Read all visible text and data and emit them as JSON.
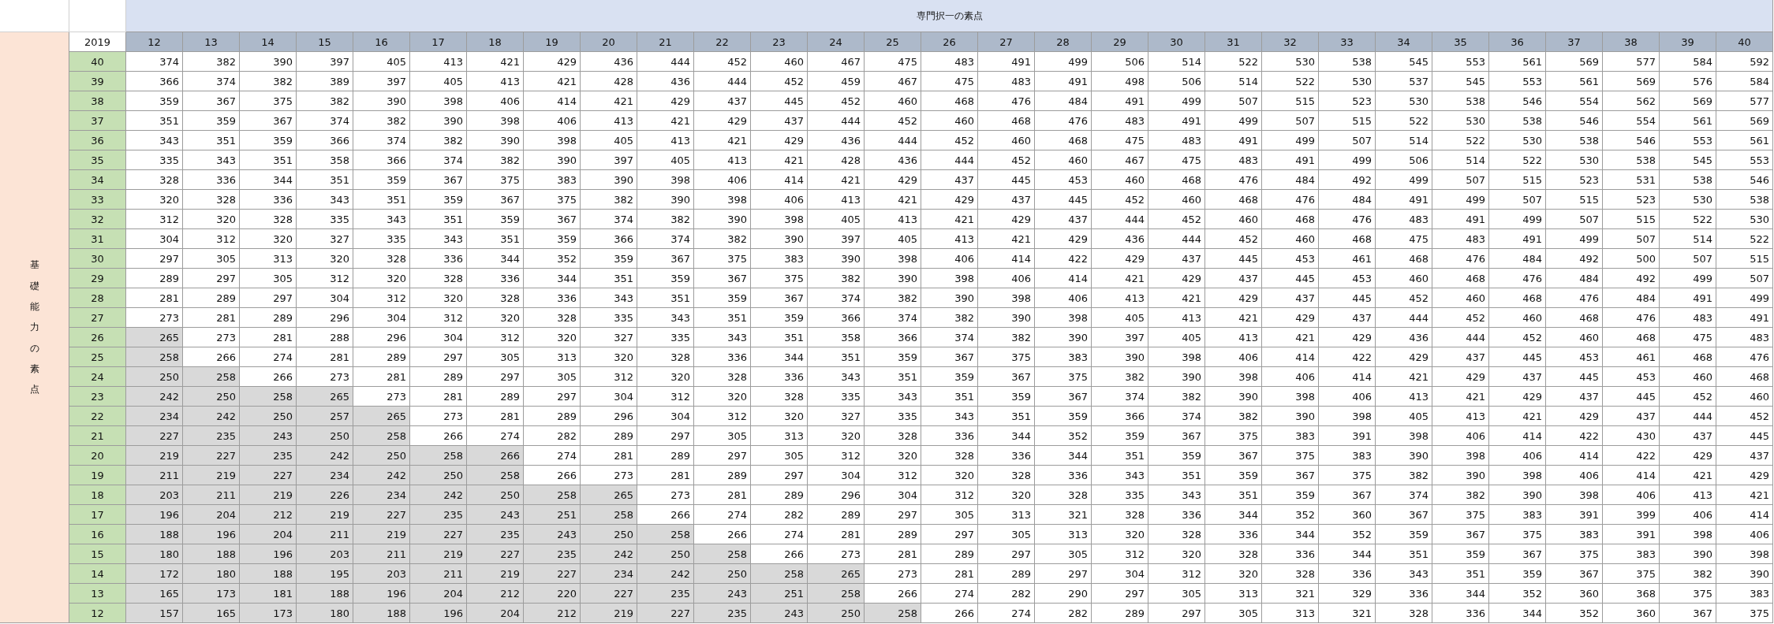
{
  "top_header": {
    "title": "専門択一の素点"
  },
  "side_header": {
    "title": "基礎能力の素点"
  },
  "table": {
    "corner": "2019",
    "columns": [
      "12",
      "13",
      "14",
      "15",
      "16",
      "17",
      "18",
      "19",
      "20",
      "21",
      "22",
      "23",
      "24",
      "25",
      "26",
      "27",
      "28",
      "29",
      "30",
      "31",
      "32",
      "33",
      "34",
      "35",
      "36",
      "37",
      "38",
      "39",
      "40"
    ],
    "rows": [
      {
        "label": "40",
        "cells": [
          "374",
          "382",
          "390",
          "397",
          "405",
          "413",
          "421",
          "429",
          "436",
          "444",
          "452",
          "460",
          "467",
          "475",
          "483",
          "491",
          "499",
          "506",
          "514",
          "522",
          "530",
          "538",
          "545",
          "553",
          "561",
          "569",
          "577",
          "584",
          "592"
        ],
        "shaded": [
          false,
          false,
          false,
          false,
          false,
          false,
          false,
          false,
          false,
          false,
          false,
          false,
          false,
          false,
          false,
          false,
          false,
          false,
          false,
          false,
          false,
          false,
          false,
          false,
          false,
          false,
          false,
          false,
          false
        ]
      },
      {
        "label": "39",
        "cells": [
          "366",
          "374",
          "382",
          "389",
          "397",
          "405",
          "413",
          "421",
          "428",
          "436",
          "444",
          "452",
          "459",
          "467",
          "475",
          "483",
          "491",
          "498",
          "506",
          "514",
          "522",
          "530",
          "537",
          "545",
          "553",
          "561",
          "569",
          "576",
          "584"
        ],
        "shaded": [
          false,
          false,
          false,
          false,
          false,
          false,
          false,
          false,
          false,
          false,
          false,
          false,
          false,
          false,
          false,
          false,
          false,
          false,
          false,
          false,
          false,
          false,
          false,
          false,
          false,
          false,
          false,
          false,
          false
        ]
      },
      {
        "label": "38",
        "cells": [
          "359",
          "367",
          "375",
          "382",
          "390",
          "398",
          "406",
          "414",
          "421",
          "429",
          "437",
          "445",
          "452",
          "460",
          "468",
          "476",
          "484",
          "491",
          "499",
          "507",
          "515",
          "523",
          "530",
          "538",
          "546",
          "554",
          "562",
          "569",
          "577"
        ],
        "shaded": [
          false,
          false,
          false,
          false,
          false,
          false,
          false,
          false,
          false,
          false,
          false,
          false,
          false,
          false,
          false,
          false,
          false,
          false,
          false,
          false,
          false,
          false,
          false,
          false,
          false,
          false,
          false,
          false,
          false
        ]
      },
      {
        "label": "37",
        "cells": [
          "351",
          "359",
          "367",
          "374",
          "382",
          "390",
          "398",
          "406",
          "413",
          "421",
          "429",
          "437",
          "444",
          "452",
          "460",
          "468",
          "476",
          "483",
          "491",
          "499",
          "507",
          "515",
          "522",
          "530",
          "538",
          "546",
          "554",
          "561",
          "569"
        ],
        "shaded": [
          false,
          false,
          false,
          false,
          false,
          false,
          false,
          false,
          false,
          false,
          false,
          false,
          false,
          false,
          false,
          false,
          false,
          false,
          false,
          false,
          false,
          false,
          false,
          false,
          false,
          false,
          false,
          false,
          false
        ]
      },
      {
        "label": "36",
        "cells": [
          "343",
          "351",
          "359",
          "366",
          "374",
          "382",
          "390",
          "398",
          "405",
          "413",
          "421",
          "429",
          "436",
          "444",
          "452",
          "460",
          "468",
          "475",
          "483",
          "491",
          "499",
          "507",
          "514",
          "522",
          "530",
          "538",
          "546",
          "553",
          "561"
        ],
        "shaded": [
          false,
          false,
          false,
          false,
          false,
          false,
          false,
          false,
          false,
          false,
          false,
          false,
          false,
          false,
          false,
          false,
          false,
          false,
          false,
          false,
          false,
          false,
          false,
          false,
          false,
          false,
          false,
          false,
          false
        ]
      },
      {
        "label": "35",
        "cells": [
          "335",
          "343",
          "351",
          "358",
          "366",
          "374",
          "382",
          "390",
          "397",
          "405",
          "413",
          "421",
          "428",
          "436",
          "444",
          "452",
          "460",
          "467",
          "475",
          "483",
          "491",
          "499",
          "506",
          "514",
          "522",
          "530",
          "538",
          "545",
          "553"
        ],
        "shaded": [
          false,
          false,
          false,
          false,
          false,
          false,
          false,
          false,
          false,
          false,
          false,
          false,
          false,
          false,
          false,
          false,
          false,
          false,
          false,
          false,
          false,
          false,
          false,
          false,
          false,
          false,
          false,
          false,
          false
        ]
      },
      {
        "label": "34",
        "cells": [
          "328",
          "336",
          "344",
          "351",
          "359",
          "367",
          "375",
          "383",
          "390",
          "398",
          "406",
          "414",
          "421",
          "429",
          "437",
          "445",
          "453",
          "460",
          "468",
          "476",
          "484",
          "492",
          "499",
          "507",
          "515",
          "523",
          "531",
          "538",
          "546"
        ],
        "shaded": [
          false,
          false,
          false,
          false,
          false,
          false,
          false,
          false,
          false,
          false,
          false,
          false,
          false,
          false,
          false,
          false,
          false,
          false,
          false,
          false,
          false,
          false,
          false,
          false,
          false,
          false,
          false,
          false,
          false
        ]
      },
      {
        "label": "33",
        "cells": [
          "320",
          "328",
          "336",
          "343",
          "351",
          "359",
          "367",
          "375",
          "382",
          "390",
          "398",
          "406",
          "413",
          "421",
          "429",
          "437",
          "445",
          "452",
          "460",
          "468",
          "476",
          "484",
          "491",
          "499",
          "507",
          "515",
          "523",
          "530",
          "538"
        ],
        "shaded": [
          false,
          false,
          false,
          false,
          false,
          false,
          false,
          false,
          false,
          false,
          false,
          false,
          false,
          false,
          false,
          false,
          false,
          false,
          false,
          false,
          false,
          false,
          false,
          false,
          false,
          false,
          false,
          false,
          false
        ]
      },
      {
        "label": "32",
        "cells": [
          "312",
          "320",
          "328",
          "335",
          "343",
          "351",
          "359",
          "367",
          "374",
          "382",
          "390",
          "398",
          "405",
          "413",
          "421",
          "429",
          "437",
          "444",
          "452",
          "460",
          "468",
          "476",
          "483",
          "491",
          "499",
          "507",
          "515",
          "522",
          "530"
        ],
        "shaded": [
          false,
          false,
          false,
          false,
          false,
          false,
          false,
          false,
          false,
          false,
          false,
          false,
          false,
          false,
          false,
          false,
          false,
          false,
          false,
          false,
          false,
          false,
          false,
          false,
          false,
          false,
          false,
          false,
          false
        ]
      },
      {
        "label": "31",
        "cells": [
          "304",
          "312",
          "320",
          "327",
          "335",
          "343",
          "351",
          "359",
          "366",
          "374",
          "382",
          "390",
          "397",
          "405",
          "413",
          "421",
          "429",
          "436",
          "444",
          "452",
          "460",
          "468",
          "475",
          "483",
          "491",
          "499",
          "507",
          "514",
          "522"
        ],
        "shaded": [
          false,
          false,
          false,
          false,
          false,
          false,
          false,
          false,
          false,
          false,
          false,
          false,
          false,
          false,
          false,
          false,
          false,
          false,
          false,
          false,
          false,
          false,
          false,
          false,
          false,
          false,
          false,
          false,
          false
        ]
      },
      {
        "label": "30",
        "cells": [
          "297",
          "305",
          "313",
          "320",
          "328",
          "336",
          "344",
          "352",
          "359",
          "367",
          "375",
          "383",
          "390",
          "398",
          "406",
          "414",
          "422",
          "429",
          "437",
          "445",
          "453",
          "461",
          "468",
          "476",
          "484",
          "492",
          "500",
          "507",
          "515"
        ],
        "shaded": [
          false,
          false,
          false,
          false,
          false,
          false,
          false,
          false,
          false,
          false,
          false,
          false,
          false,
          false,
          false,
          false,
          false,
          false,
          false,
          false,
          false,
          false,
          false,
          false,
          false,
          false,
          false,
          false,
          false
        ]
      },
      {
        "label": "29",
        "cells": [
          "289",
          "297",
          "305",
          "312",
          "320",
          "328",
          "336",
          "344",
          "351",
          "359",
          "367",
          "375",
          "382",
          "390",
          "398",
          "406",
          "414",
          "421",
          "429",
          "437",
          "445",
          "453",
          "460",
          "468",
          "476",
          "484",
          "492",
          "499",
          "507"
        ],
        "shaded": [
          false,
          false,
          false,
          false,
          false,
          false,
          false,
          false,
          false,
          false,
          false,
          false,
          false,
          false,
          false,
          false,
          false,
          false,
          false,
          false,
          false,
          false,
          false,
          false,
          false,
          false,
          false,
          false,
          false
        ]
      },
      {
        "label": "28",
        "cells": [
          "281",
          "289",
          "297",
          "304",
          "312",
          "320",
          "328",
          "336",
          "343",
          "351",
          "359",
          "367",
          "374",
          "382",
          "390",
          "398",
          "406",
          "413",
          "421",
          "429",
          "437",
          "445",
          "452",
          "460",
          "468",
          "476",
          "484",
          "491",
          "499"
        ],
        "shaded": [
          false,
          false,
          false,
          false,
          false,
          false,
          false,
          false,
          false,
          false,
          false,
          false,
          false,
          false,
          false,
          false,
          false,
          false,
          false,
          false,
          false,
          false,
          false,
          false,
          false,
          false,
          false,
          false,
          false
        ]
      },
      {
        "label": "27",
        "cells": [
          "273",
          "281",
          "289",
          "296",
          "304",
          "312",
          "320",
          "328",
          "335",
          "343",
          "351",
          "359",
          "366",
          "374",
          "382",
          "390",
          "398",
          "405",
          "413",
          "421",
          "429",
          "437",
          "444",
          "452",
          "460",
          "468",
          "476",
          "483",
          "491"
        ],
        "shaded": [
          false,
          false,
          false,
          false,
          false,
          false,
          false,
          false,
          false,
          false,
          false,
          false,
          false,
          false,
          false,
          false,
          false,
          false,
          false,
          false,
          false,
          false,
          false,
          false,
          false,
          false,
          false,
          false,
          false
        ]
      },
      {
        "label": "26",
        "cells": [
          "265",
          "273",
          "281",
          "288",
          "296",
          "304",
          "312",
          "320",
          "327",
          "335",
          "343",
          "351",
          "358",
          "366",
          "374",
          "382",
          "390",
          "397",
          "405",
          "413",
          "421",
          "429",
          "436",
          "444",
          "452",
          "460",
          "468",
          "475",
          "483"
        ],
        "shaded": [
          true,
          false,
          false,
          false,
          false,
          false,
          false,
          false,
          false,
          false,
          false,
          false,
          false,
          false,
          false,
          false,
          false,
          false,
          false,
          false,
          false,
          false,
          false,
          false,
          false,
          false,
          false,
          false,
          false
        ]
      },
      {
        "label": "25",
        "cells": [
          "258",
          "266",
          "274",
          "281",
          "289",
          "297",
          "305",
          "313",
          "320",
          "328",
          "336",
          "344",
          "351",
          "359",
          "367",
          "375",
          "383",
          "390",
          "398",
          "406",
          "414",
          "422",
          "429",
          "437",
          "445",
          "453",
          "461",
          "468",
          "476"
        ],
        "shaded": [
          true,
          false,
          false,
          false,
          false,
          false,
          false,
          false,
          false,
          false,
          false,
          false,
          false,
          false,
          false,
          false,
          false,
          false,
          false,
          false,
          false,
          false,
          false,
          false,
          false,
          false,
          false,
          false,
          false
        ]
      },
      {
        "label": "24",
        "cells": [
          "250",
          "258",
          "266",
          "273",
          "281",
          "289",
          "297",
          "305",
          "312",
          "320",
          "328",
          "336",
          "343",
          "351",
          "359",
          "367",
          "375",
          "382",
          "390",
          "398",
          "406",
          "414",
          "421",
          "429",
          "437",
          "445",
          "453",
          "460",
          "468"
        ],
        "shaded": [
          true,
          true,
          false,
          false,
          false,
          false,
          false,
          false,
          false,
          false,
          false,
          false,
          false,
          false,
          false,
          false,
          false,
          false,
          false,
          false,
          false,
          false,
          false,
          false,
          false,
          false,
          false,
          false,
          false
        ]
      },
      {
        "label": "23",
        "cells": [
          "242",
          "250",
          "258",
          "265",
          "273",
          "281",
          "289",
          "297",
          "304",
          "312",
          "320",
          "328",
          "335",
          "343",
          "351",
          "359",
          "367",
          "374",
          "382",
          "390",
          "398",
          "406",
          "413",
          "421",
          "429",
          "437",
          "445",
          "452",
          "460"
        ],
        "shaded": [
          true,
          true,
          true,
          true,
          false,
          false,
          false,
          false,
          false,
          false,
          false,
          false,
          false,
          false,
          false,
          false,
          false,
          false,
          false,
          false,
          false,
          false,
          false,
          false,
          false,
          false,
          false,
          false,
          false
        ]
      },
      {
        "label": "22",
        "cells": [
          "234",
          "242",
          "250",
          "257",
          "265",
          "273",
          "281",
          "289",
          "296",
          "304",
          "312",
          "320",
          "327",
          "335",
          "343",
          "351",
          "359",
          "366",
          "374",
          "382",
          "390",
          "398",
          "405",
          "413",
          "421",
          "429",
          "437",
          "444",
          "452"
        ],
        "shaded": [
          true,
          true,
          true,
          true,
          true,
          false,
          false,
          false,
          false,
          false,
          false,
          false,
          false,
          false,
          false,
          false,
          false,
          false,
          false,
          false,
          false,
          false,
          false,
          false,
          false,
          false,
          false,
          false,
          false
        ]
      },
      {
        "label": "21",
        "cells": [
          "227",
          "235",
          "243",
          "250",
          "258",
          "266",
          "274",
          "282",
          "289",
          "297",
          "305",
          "313",
          "320",
          "328",
          "336",
          "344",
          "352",
          "359",
          "367",
          "375",
          "383",
          "391",
          "398",
          "406",
          "414",
          "422",
          "430",
          "437",
          "445"
        ],
        "shaded": [
          true,
          true,
          true,
          true,
          true,
          false,
          false,
          false,
          false,
          false,
          false,
          false,
          false,
          false,
          false,
          false,
          false,
          false,
          false,
          false,
          false,
          false,
          false,
          false,
          false,
          false,
          false,
          false,
          false
        ]
      },
      {
        "label": "20",
        "cells": [
          "219",
          "227",
          "235",
          "242",
          "250",
          "258",
          "266",
          "274",
          "281",
          "289",
          "297",
          "305",
          "312",
          "320",
          "328",
          "336",
          "344",
          "351",
          "359",
          "367",
          "375",
          "383",
          "390",
          "398",
          "406",
          "414",
          "422",
          "429",
          "437"
        ],
        "shaded": [
          true,
          true,
          true,
          true,
          true,
          true,
          true,
          false,
          false,
          false,
          false,
          false,
          false,
          false,
          false,
          false,
          false,
          false,
          false,
          false,
          false,
          false,
          false,
          false,
          false,
          false,
          false,
          false,
          false
        ]
      },
      {
        "label": "19",
        "cells": [
          "211",
          "219",
          "227",
          "234",
          "242",
          "250",
          "258",
          "266",
          "273",
          "281",
          "289",
          "297",
          "304",
          "312",
          "320",
          "328",
          "336",
          "343",
          "351",
          "359",
          "367",
          "375",
          "382",
          "390",
          "398",
          "406",
          "414",
          "421",
          "429"
        ],
        "shaded": [
          true,
          true,
          true,
          true,
          true,
          true,
          true,
          false,
          false,
          false,
          false,
          false,
          false,
          false,
          false,
          false,
          false,
          false,
          false,
          false,
          false,
          false,
          false,
          false,
          false,
          false,
          false,
          false,
          false
        ]
      },
      {
        "label": "18",
        "cells": [
          "203",
          "211",
          "219",
          "226",
          "234",
          "242",
          "250",
          "258",
          "265",
          "273",
          "281",
          "289",
          "296",
          "304",
          "312",
          "320",
          "328",
          "335",
          "343",
          "351",
          "359",
          "367",
          "374",
          "382",
          "390",
          "398",
          "406",
          "413",
          "421"
        ],
        "shaded": [
          true,
          true,
          true,
          true,
          true,
          true,
          true,
          true,
          true,
          false,
          false,
          false,
          false,
          false,
          false,
          false,
          false,
          false,
          false,
          false,
          false,
          false,
          false,
          false,
          false,
          false,
          false,
          false,
          false
        ]
      },
      {
        "label": "17",
        "cells": [
          "196",
          "204",
          "212",
          "219",
          "227",
          "235",
          "243",
          "251",
          "258",
          "266",
          "274",
          "282",
          "289",
          "297",
          "305",
          "313",
          "321",
          "328",
          "336",
          "344",
          "352",
          "360",
          "367",
          "375",
          "383",
          "391",
          "399",
          "406",
          "414"
        ],
        "shaded": [
          true,
          true,
          true,
          true,
          true,
          true,
          true,
          true,
          true,
          false,
          false,
          false,
          false,
          false,
          false,
          false,
          false,
          false,
          false,
          false,
          false,
          false,
          false,
          false,
          false,
          false,
          false,
          false,
          false
        ]
      },
      {
        "label": "16",
        "cells": [
          "188",
          "196",
          "204",
          "211",
          "219",
          "227",
          "235",
          "243",
          "250",
          "258",
          "266",
          "274",
          "281",
          "289",
          "297",
          "305",
          "313",
          "320",
          "328",
          "336",
          "344",
          "352",
          "359",
          "367",
          "375",
          "383",
          "391",
          "398",
          "406"
        ],
        "shaded": [
          true,
          true,
          true,
          true,
          true,
          true,
          true,
          true,
          true,
          true,
          false,
          false,
          false,
          false,
          false,
          false,
          false,
          false,
          false,
          false,
          false,
          false,
          false,
          false,
          false,
          false,
          false,
          false,
          false
        ]
      },
      {
        "label": "15",
        "cells": [
          "180",
          "188",
          "196",
          "203",
          "211",
          "219",
          "227",
          "235",
          "242",
          "250",
          "258",
          "266",
          "273",
          "281",
          "289",
          "297",
          "305",
          "312",
          "320",
          "328",
          "336",
          "344",
          "351",
          "359",
          "367",
          "375",
          "383",
          "390",
          "398"
        ],
        "shaded": [
          true,
          true,
          true,
          true,
          true,
          true,
          true,
          true,
          true,
          true,
          true,
          false,
          false,
          false,
          false,
          false,
          false,
          false,
          false,
          false,
          false,
          false,
          false,
          false,
          false,
          false,
          false,
          false,
          false
        ]
      },
      {
        "label": "14",
        "cells": [
          "172",
          "180",
          "188",
          "195",
          "203",
          "211",
          "219",
          "227",
          "234",
          "242",
          "250",
          "258",
          "265",
          "273",
          "281",
          "289",
          "297",
          "304",
          "312",
          "320",
          "328",
          "336",
          "343",
          "351",
          "359",
          "367",
          "375",
          "382",
          "390"
        ],
        "shaded": [
          true,
          true,
          true,
          true,
          true,
          true,
          true,
          true,
          true,
          true,
          true,
          true,
          true,
          false,
          false,
          false,
          false,
          false,
          false,
          false,
          false,
          false,
          false,
          false,
          false,
          false,
          false,
          false,
          false
        ]
      },
      {
        "label": "13",
        "cells": [
          "165",
          "173",
          "181",
          "188",
          "196",
          "204",
          "212",
          "220",
          "227",
          "235",
          "243",
          "251",
          "258",
          "266",
          "274",
          "282",
          "290",
          "297",
          "305",
          "313",
          "321",
          "329",
          "336",
          "344",
          "352",
          "360",
          "368",
          "375",
          "383"
        ],
        "shaded": [
          true,
          true,
          true,
          true,
          true,
          true,
          true,
          true,
          true,
          true,
          true,
          true,
          true,
          false,
          false,
          false,
          false,
          false,
          false,
          false,
          false,
          false,
          false,
          false,
          false,
          false,
          false,
          false,
          false
        ]
      },
      {
        "label": "12",
        "cells": [
          "157",
          "165",
          "173",
          "180",
          "188",
          "196",
          "204",
          "212",
          "219",
          "227",
          "235",
          "243",
          "250",
          "258",
          "266",
          "274",
          "282",
          "289",
          "297",
          "305",
          "313",
          "321",
          "328",
          "336",
          "344",
          "352",
          "360",
          "367",
          "375"
        ],
        "shaded": [
          true,
          true,
          true,
          true,
          true,
          true,
          true,
          true,
          true,
          true,
          true,
          true,
          true,
          true,
          false,
          false,
          false,
          false,
          false,
          false,
          false,
          false,
          false,
          false,
          false,
          false,
          false,
          false,
          false
        ]
      }
    ]
  }
}
